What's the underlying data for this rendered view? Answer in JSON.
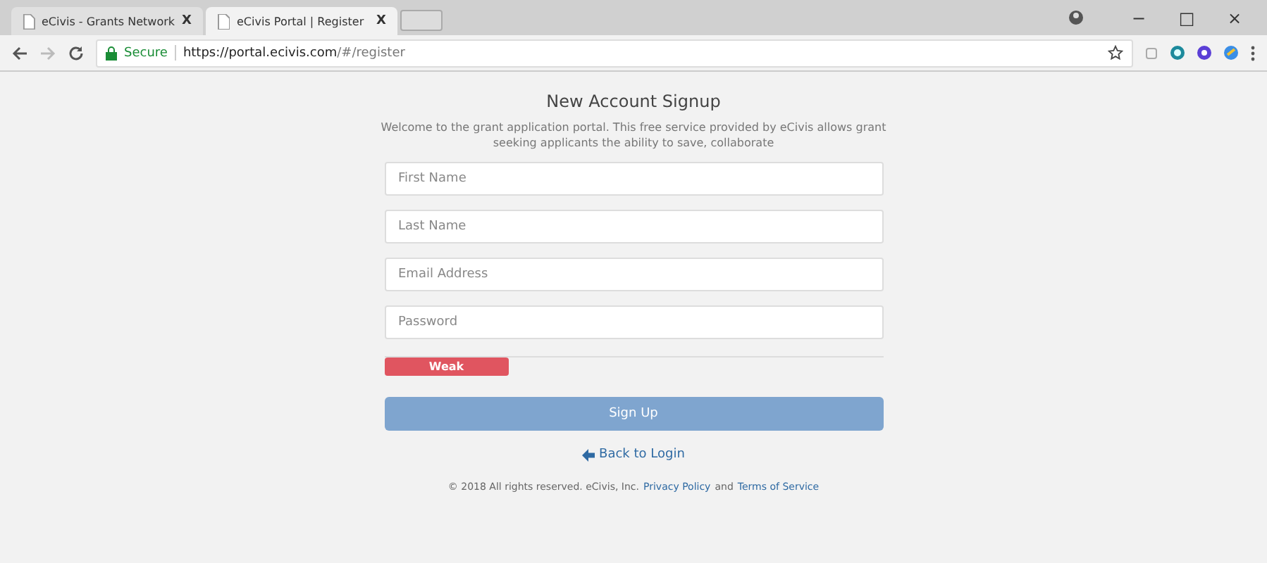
{
  "browser": {
    "tabs": [
      {
        "title": "eCivis - Grants Network",
        "close": "X",
        "selected": false
      },
      {
        "title": "eCivis Portal | Register",
        "close": "X",
        "selected": true
      }
    ],
    "window_controls": [
      "−",
      "□",
      "×"
    ],
    "address": {
      "secure_label": "Secure",
      "url_host": "https://portal.ecivis.com",
      "url_path": "/#/register"
    }
  },
  "page": {
    "title": "New Account Signup",
    "intro": "Welcome to the grant application portal. This free service provided by eCivis allows grant seeking applicants the ability to save, collaborate",
    "fields": [
      {
        "placeholder": "First Name"
      },
      {
        "placeholder": "Last Name"
      },
      {
        "placeholder": "Email Address"
      },
      {
        "placeholder": "Password"
      }
    ],
    "strength": {
      "label": "Weak",
      "level": 0.25
    },
    "submit": {
      "label": "Sign Up",
      "disabled": true
    },
    "back_link": "Back to Login",
    "footer": {
      "copyright": "© 2018 All rights reserved. eCivis, Inc.",
      "privacy": "Privacy Policy",
      "and": "and",
      "terms": "Terms of Service"
    }
  }
}
